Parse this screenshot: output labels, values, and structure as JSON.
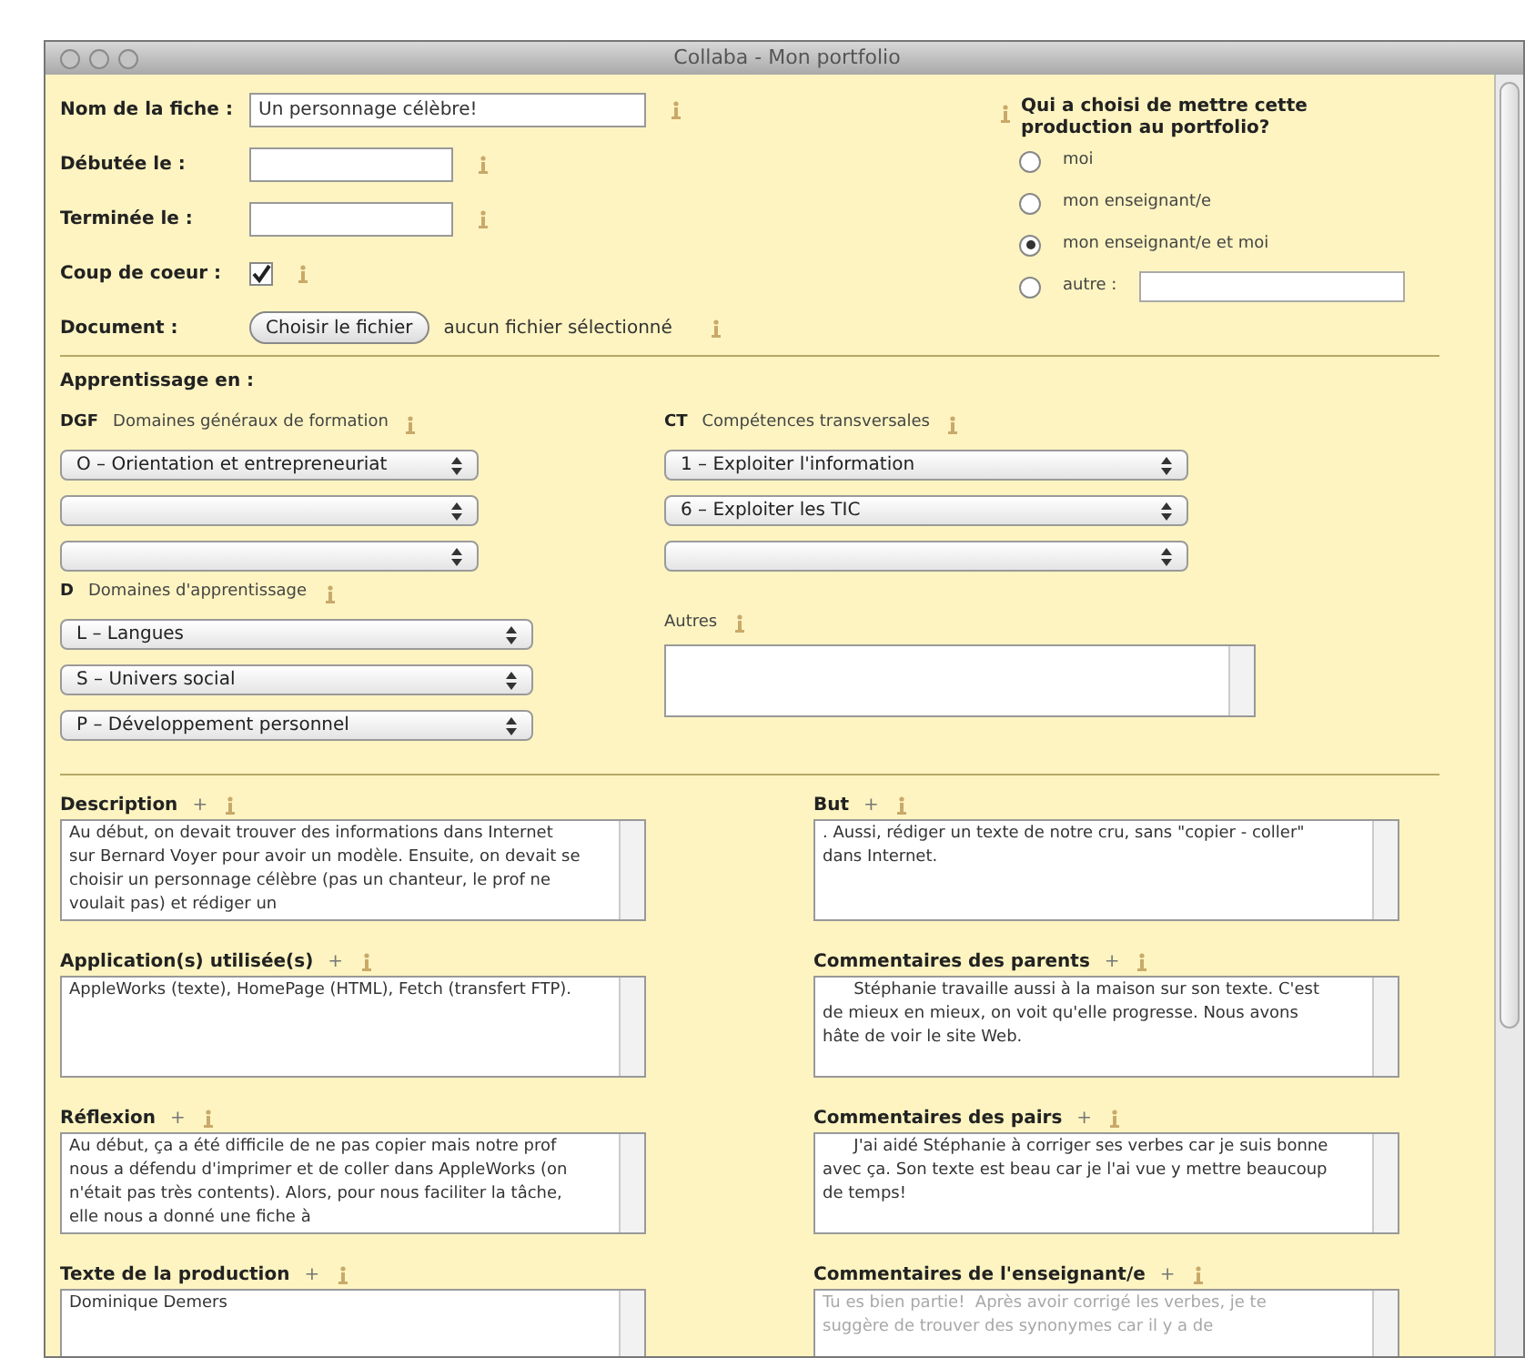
{
  "window": {
    "title": "Collaba - Mon portfolio"
  },
  "header_fields": [
    {
      "kind": "text",
      "label": "Nom de la fiche :",
      "value": "Un personnage célèbre!"
    },
    {
      "kind": "text",
      "label": "Débutée le :"
    },
    {
      "kind": "text",
      "label": "Terminée le :"
    },
    {
      "kind": "checkbox",
      "label": "Coup de coeur :",
      "checked": true
    },
    {
      "kind": "file",
      "label": "Document :",
      "button": "Choisir le fichier",
      "status": "aucun fichier sélectionné"
    }
  ],
  "chooser": {
    "question": "Qui a choisi de mettre cette production au portfolio?",
    "options": [
      {
        "kind": "plain",
        "label": "moi",
        "selected": false
      },
      {
        "kind": "plain",
        "label": "mon enseignant/e",
        "selected": false
      },
      {
        "kind": "plain",
        "label": "mon enseignant/e et moi",
        "selected": true
      },
      {
        "kind": "with_field",
        "label": "autre :",
        "selected": false
      }
    ]
  },
  "learning": {
    "title": "Apprentissage en :",
    "dgf": {
      "code": "DGF",
      "label": "Domaines généraux de formation",
      "selects": [
        {
          "value": "O – Orientation et entrepreneuriat"
        }
      ]
    },
    "ct": {
      "code": "CT",
      "label": "Compétences transversales",
      "selects": [
        {
          "value": "1 – Exploiter l'information"
        },
        {
          "value": "6 – Exploiter les TIC"
        }
      ]
    },
    "d": {
      "code": "D",
      "label": "Domaines d'apprentissage",
      "selects": [
        {
          "value": "L – Langues"
        },
        {
          "value": "S – Univers social"
        },
        {
          "value": "P – Développement personnel"
        }
      ]
    },
    "others": {
      "label": "Autres"
    }
  },
  "left_notes": [
    {
      "label": "Description",
      "plus": "+",
      "value": "Au début, on devait trouver des informations dans Internet sur Bernard Voyer pour avoir un modèle. Ensuite, on devait se choisir un personnage célèbre (pas un chanteur, le prof ne voulait pas) et rédiger un",
      "faded": false
    },
    {
      "label": "Application(s) utilisée(s)",
      "plus": "+",
      "value": "AppleWorks (texte), HomePage (HTML), Fetch (transfert FTP).",
      "faded": false
    },
    {
      "label": "Réflexion",
      "plus": "+",
      "value": "Au début, ça a été difficile de ne pas copier mais notre prof nous a défendu d'imprimer et de coller dans AppleWorks (on n'était pas très contents). Alors, pour nous faciliter la tâche, elle nous a donné une fiche à",
      "faded": false
    },
    {
      "label": "Texte de la production",
      "plus": "+",
      "value": "Dominique Demers",
      "faded": false
    }
  ],
  "right_notes": [
    {
      "label": "But",
      "plus": "+",
      "value": ". Aussi, rédiger un texte de notre cru, sans \"copier - coller\" dans Internet.",
      "faded": false
    },
    {
      "label": "Commentaires des parents",
      "plus": "+",
      "value": "      Stéphanie travaille aussi à la maison sur son texte. C'est de mieux en mieux, on voit qu'elle progresse. Nous avons hâte de voir le site Web.",
      "faded": false
    },
    {
      "label": "Commentaires des pairs",
      "plus": "+",
      "value": "      J'ai aidé Stéphanie à corriger ses verbes car je suis bonne avec ça. Son texte est beau car je l'ai vue y mettre beaucoup de temps!",
      "faded": false
    },
    {
      "label": "Commentaires de l'enseignant/e",
      "plus": "+",
      "value": "Tu es bien partie!  Après avoir corrigé les verbes, je te suggère de trouver des synonymes car il y a de",
      "faded": true
    }
  ]
}
